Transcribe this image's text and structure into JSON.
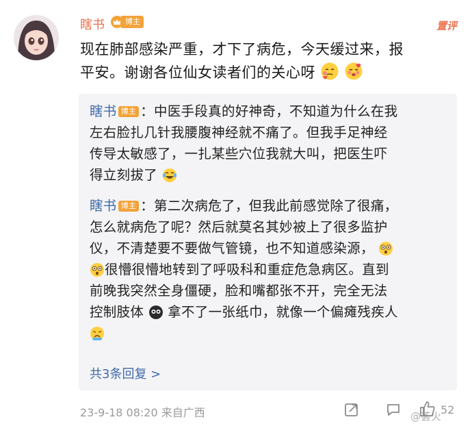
{
  "post": {
    "username": "瞎书",
    "badge": "博主",
    "top_action": "置评",
    "text_line1": "现在肺部感染严重，才下了病危，今天缓过来，报",
    "text_line2": "平安。谢谢各位仙女读者们的关心呀",
    "avatar_icon": "girl-avatar",
    "timestamp": "23-9-18 08:20",
    "source": "来自广西",
    "like_count": "52"
  },
  "replies": [
    {
      "name": "瞎书",
      "badge": "博主",
      "l1": "：中医手段真的好神奇，不知道为什么在我",
      "l2": "左右脸扎几针我腰腹神经就不痛了。但我手足神经",
      "l3": "传导太敏感了，一扎某些穴位我就大叫，把医生吓",
      "l4": "得立刻拔了"
    },
    {
      "name": "瞎书",
      "badge": "博主",
      "l1": "：第二次病危了，但我此前感觉除了很痛，",
      "l2": "怎么就病危了呢？然后就莫名其妙被上了很多监护",
      "l3": "仪，不清楚要不要做气管镜，也不知道感染源，",
      "l4": "很懵很懵地转到了呼吸科和重症危急病区。直到",
      "l5": "前晚我突然全身僵硬，脸和嘴都张不开，完全无法",
      "l6a": "控制肢体",
      "l6b": "拿不了一张纸巾，就像一个偏瘫残疾人"
    }
  ],
  "more_replies": "共3条回复 >",
  "watermark": "@荟火",
  "colors": {
    "accent": "#eb7350",
    "link": "#3f6aa8",
    "badge": "#f2a33a",
    "reply_bg": "#f4f4f6"
  }
}
